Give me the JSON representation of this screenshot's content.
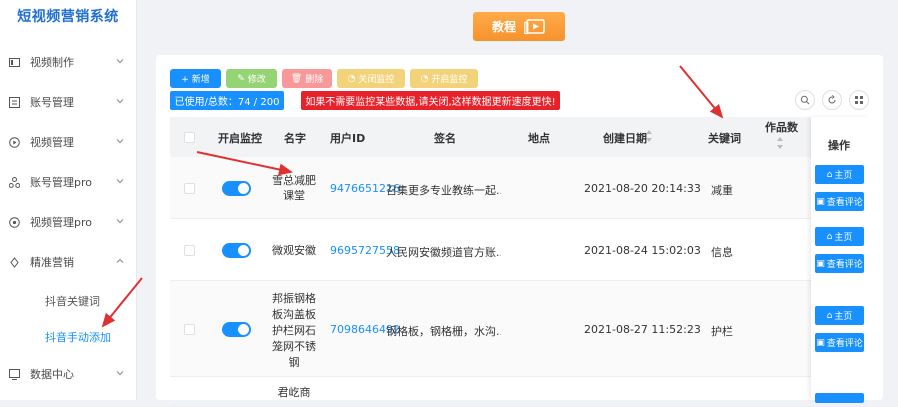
{
  "app": {
    "title": "短视频营销系统"
  },
  "sidebar": {
    "items": [
      {
        "label": "视频制作",
        "icon": "video-make-icon"
      },
      {
        "label": "账号管理",
        "icon": "account-icon"
      },
      {
        "label": "视频管理",
        "icon": "video-manage-icon"
      },
      {
        "label": "账号管理pro",
        "icon": "account-pro-icon"
      },
      {
        "label": "视频管理pro",
        "icon": "video-pro-icon"
      },
      {
        "label": "精准营销",
        "icon": "marketing-icon"
      },
      {
        "label": "数据中心",
        "icon": "data-icon"
      }
    ],
    "sub_items": [
      {
        "label": "抖音关键词"
      },
      {
        "label": "抖音手动添加"
      }
    ]
  },
  "top": {
    "tutorial_label": "教程"
  },
  "toolbar": {
    "add_label": "+ 新增",
    "edit_label": "修改",
    "delete_label": "删除",
    "stop_monitor_label": "关闭监控",
    "start_monitor_label": "开启监控",
    "usage_text": "已使用/总数：74 / 200",
    "warning_text": "如果不需要监控某些数据,请关闭,这样数据更新速度更快!"
  },
  "table": {
    "headers": {
      "monitor": "开启监控",
      "name": "名字",
      "uid": "用户ID",
      "sign": "签名",
      "location": "地点",
      "created": "创建日期",
      "keyword": "关键词",
      "works": "作品数",
      "ops": "操作"
    },
    "rows": [
      {
        "name": "雪总减肥课堂",
        "uid": "9476651216",
        "sign": "召集更多专业教练一起...",
        "location": "",
        "created": "2021-08-20 20:14:33",
        "keyword": "减重",
        "works": ""
      },
      {
        "name": "微观安徽",
        "uid": "9695727558",
        "sign": "人民网安徽频道官方账...",
        "location": "",
        "created": "2021-08-24 15:02:03",
        "keyword": "信息",
        "works": ""
      },
      {
        "name": "邦振钢格板沟盖板护栏网石笼网不锈钢",
        "uid": "7098646492",
        "sign": "钢格板，钢格栅，水沟...",
        "location": "",
        "created": "2021-08-27 11:52:23",
        "keyword": "护栏",
        "works": ""
      },
      {
        "name": "君屹商",
        "uid": "",
        "sign": "",
        "location": "",
        "created": "",
        "keyword": "",
        "works": ""
      }
    ],
    "op_home_label": "主页",
    "op_comment_label": "查看评论"
  },
  "colors": {
    "primary": "#1890ff",
    "danger": "#e8222b",
    "orange": "#f7922c",
    "success": "#67c23a"
  }
}
